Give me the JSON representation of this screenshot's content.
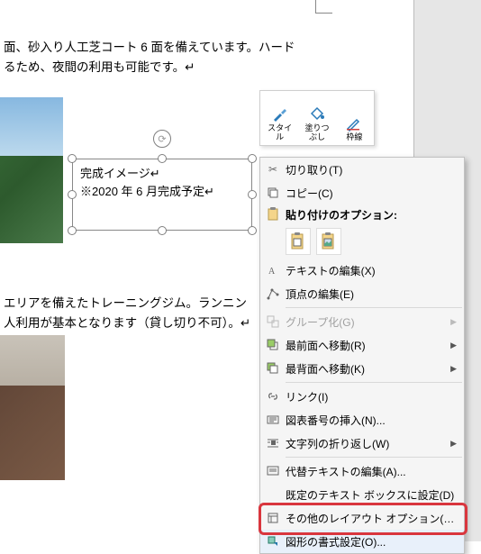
{
  "body_text": {
    "line1": "面、砂入り人工芝コート 6 面を備えています。ハード",
    "line2": "るため、夜間の利用も可能です。↵",
    "line3": "エリアを備えたトレーニングジム。ランニン",
    "line4": "人利用が基本となります（貸し切り不可）。↵"
  },
  "textbox": {
    "l1": "完成イメージ↵",
    "l2": "※2020 年 6 月完成予定↵"
  },
  "mini_toolbar": {
    "style": "スタイ\nル",
    "fill": "塗りつ\nぶし",
    "outline": "枠線"
  },
  "menu": {
    "cut": "切り取り(T)",
    "copy": "コピー(C)",
    "paste_header": "貼り付けのオプション:",
    "edit_text": "テキストの編集(X)",
    "edit_points": "頂点の編集(E)",
    "group": "グループ化(G)",
    "bring_front": "最前面へ移動(R)",
    "send_back": "最背面へ移動(K)",
    "link": "リンク(I)",
    "caption": "図表番号の挿入(N)...",
    "wrap": "文字列の折り返し(W)",
    "alt_text": "代替テキストの編集(A)...",
    "default_tb": "既定のテキスト ボックスに設定(D)",
    "more_layout": "その他のレイアウト オプション(L)...",
    "format_shape": "図形の書式設定(O)..."
  }
}
